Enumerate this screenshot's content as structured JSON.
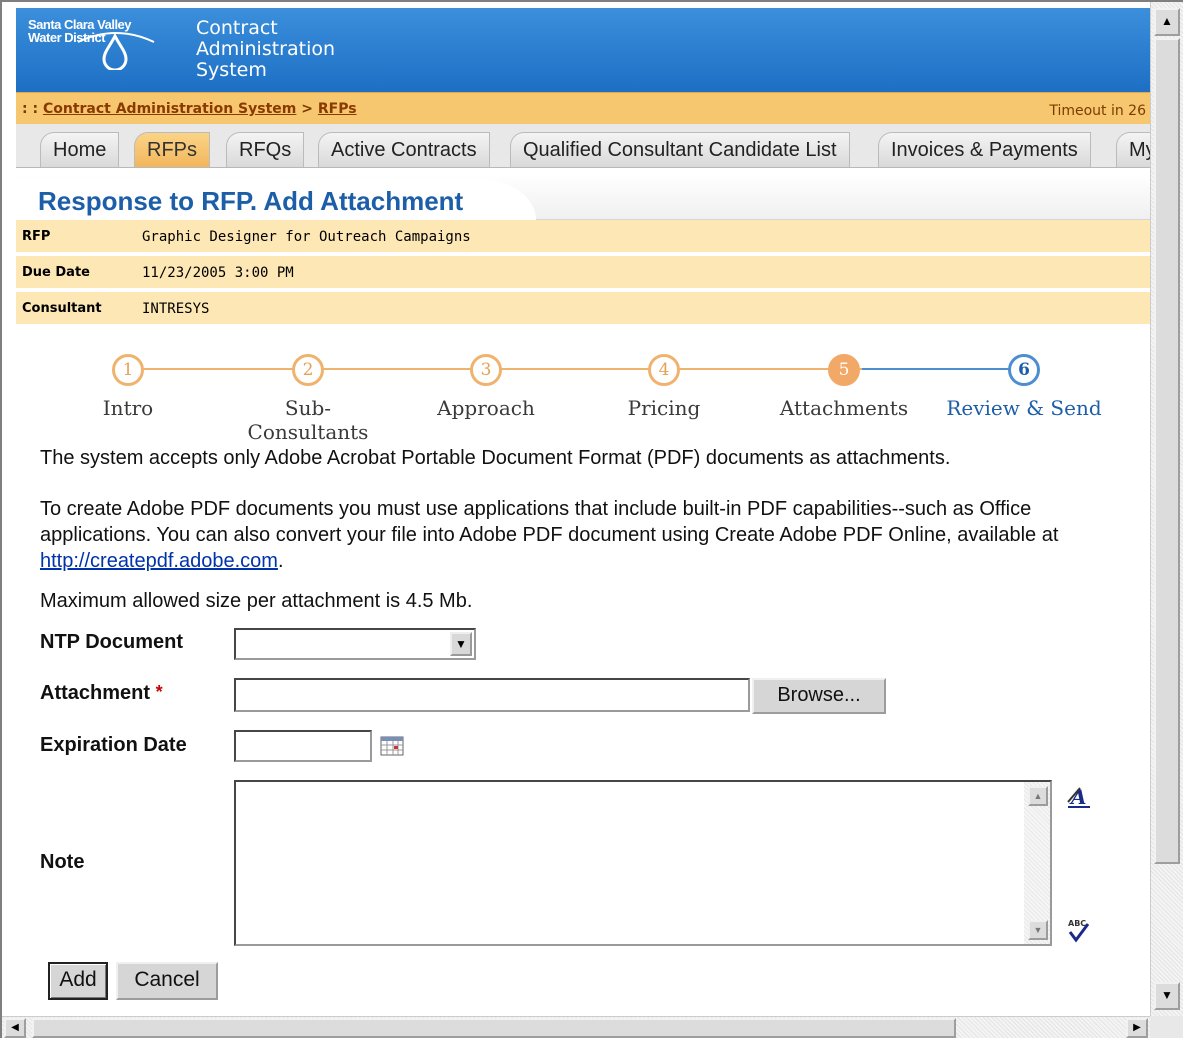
{
  "header": {
    "logo_line1": "Santa Clara Valley",
    "logo_line2": "Water District",
    "app_title_line1": "Contract",
    "app_title_line2": "Administration",
    "app_title_line3": "System"
  },
  "breadcrumb": {
    "prefix": ": : ",
    "root": "Contract Administration System",
    "separator": " > ",
    "current": "RFPs"
  },
  "timeout_text": "Timeout in 26",
  "tabs": [
    {
      "label": "Home"
    },
    {
      "label": "RFPs"
    },
    {
      "label": "RFQs"
    },
    {
      "label": "Active Contracts"
    },
    {
      "label": "Qualified Consultant Candidate List"
    },
    {
      "label": "Invoices & Payments"
    },
    {
      "label": "My"
    }
  ],
  "active_tab": "RFPs",
  "page_title": "Response to RFP. Add Attachment",
  "info": {
    "rfp_label": "RFP",
    "rfp_value": "Graphic Designer for Outreach Campaigns",
    "due_label": "Due Date",
    "due_value": "11/23/2005 3:00 PM",
    "consultant_label": "Consultant",
    "consultant_value": "INTRESYS"
  },
  "steps": [
    {
      "num": "1",
      "label": "Intro"
    },
    {
      "num": "2",
      "label": "Sub-Consultants"
    },
    {
      "num": "3",
      "label": "Approach"
    },
    {
      "num": "4",
      "label": "Pricing"
    },
    {
      "num": "5",
      "label": "Attachments"
    },
    {
      "num": "6",
      "label": "Review & Send"
    }
  ],
  "current_step": 5,
  "text": {
    "pdf_only": "The system accepts only Adobe Acrobat Portable Document Format (PDF) documents as attachments.",
    "create_pdf": "To create Adobe PDF documents you must use applications that include built-in PDF capabilities--such as Office applications. You can also convert your file into Adobe PDF document using Create Adobe PDF Online, available at",
    "create_pdf_link": "http://createpdf.adobe.com",
    "create_pdf_end": ".",
    "max_size": "Maximum allowed size per attachment is 4.5 Mb."
  },
  "form": {
    "ntp_label": "NTP Document",
    "ntp_value": "",
    "attachment_label": "Attachment",
    "attachment_required_mark": "*",
    "attachment_value": "",
    "browse_label": "Browse...",
    "expiration_label": "Expiration Date",
    "expiration_value": "",
    "note_label": "Note",
    "note_value": "",
    "add_label": "Add",
    "cancel_label": "Cancel"
  },
  "colors": {
    "header_blue": "#1d6fc4",
    "breadcrumb_orange": "#f7c770",
    "info_row": "#fde7b5",
    "title_blue": "#1d5ea8",
    "step_orange": "#f0b36e",
    "step_current": "#f2a968",
    "step_next_blue": "#4d8ed1"
  },
  "icons": {
    "logo": "water-drop-icon",
    "calendar": "calendar-icon",
    "format": "text-format-icon",
    "spellcheck": "spellcheck-icon"
  }
}
